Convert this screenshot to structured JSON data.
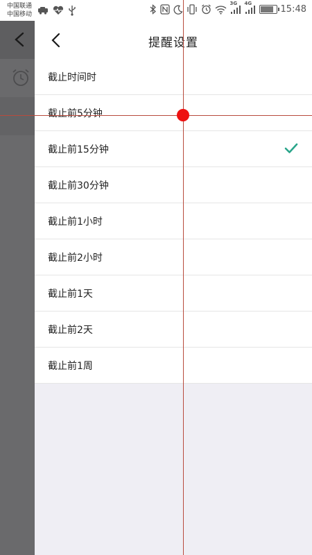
{
  "status_bar": {
    "carrier_1": "中国联通",
    "carrier_2": "中国移动",
    "network_1": "3G",
    "network_2": "4G",
    "time": "15:48",
    "icons": [
      "car-icon",
      "heart-icon",
      "usb-icon",
      "bluetooth-icon",
      "nfc-icon",
      "moon-icon",
      "vibrate-icon",
      "alarm-icon",
      "wifi-icon",
      "signal-icon",
      "battery-icon"
    ]
  },
  "background_page": {
    "icons": [
      "back-chevron-icon",
      "alarm-clock-icon"
    ]
  },
  "header": {
    "title": "提醒设置"
  },
  "options": [
    {
      "label": "截止时间时",
      "selected": false
    },
    {
      "label": "截止前5分钟",
      "selected": false
    },
    {
      "label": "截止前15分钟",
      "selected": true
    },
    {
      "label": "截止前30分钟",
      "selected": false
    },
    {
      "label": "截止前1小时",
      "selected": false
    },
    {
      "label": "截止前2小时",
      "selected": false
    },
    {
      "label": "截止前1天",
      "selected": false
    },
    {
      "label": "截止前2天",
      "selected": false
    },
    {
      "label": "截止前1周",
      "selected": false
    }
  ],
  "colors": {
    "check": "#2aa58a",
    "panel_bg": "#efeef4",
    "overlay": "#6d6d6f",
    "guide": "#b84a3c",
    "guide_dot": "#ee1111"
  }
}
